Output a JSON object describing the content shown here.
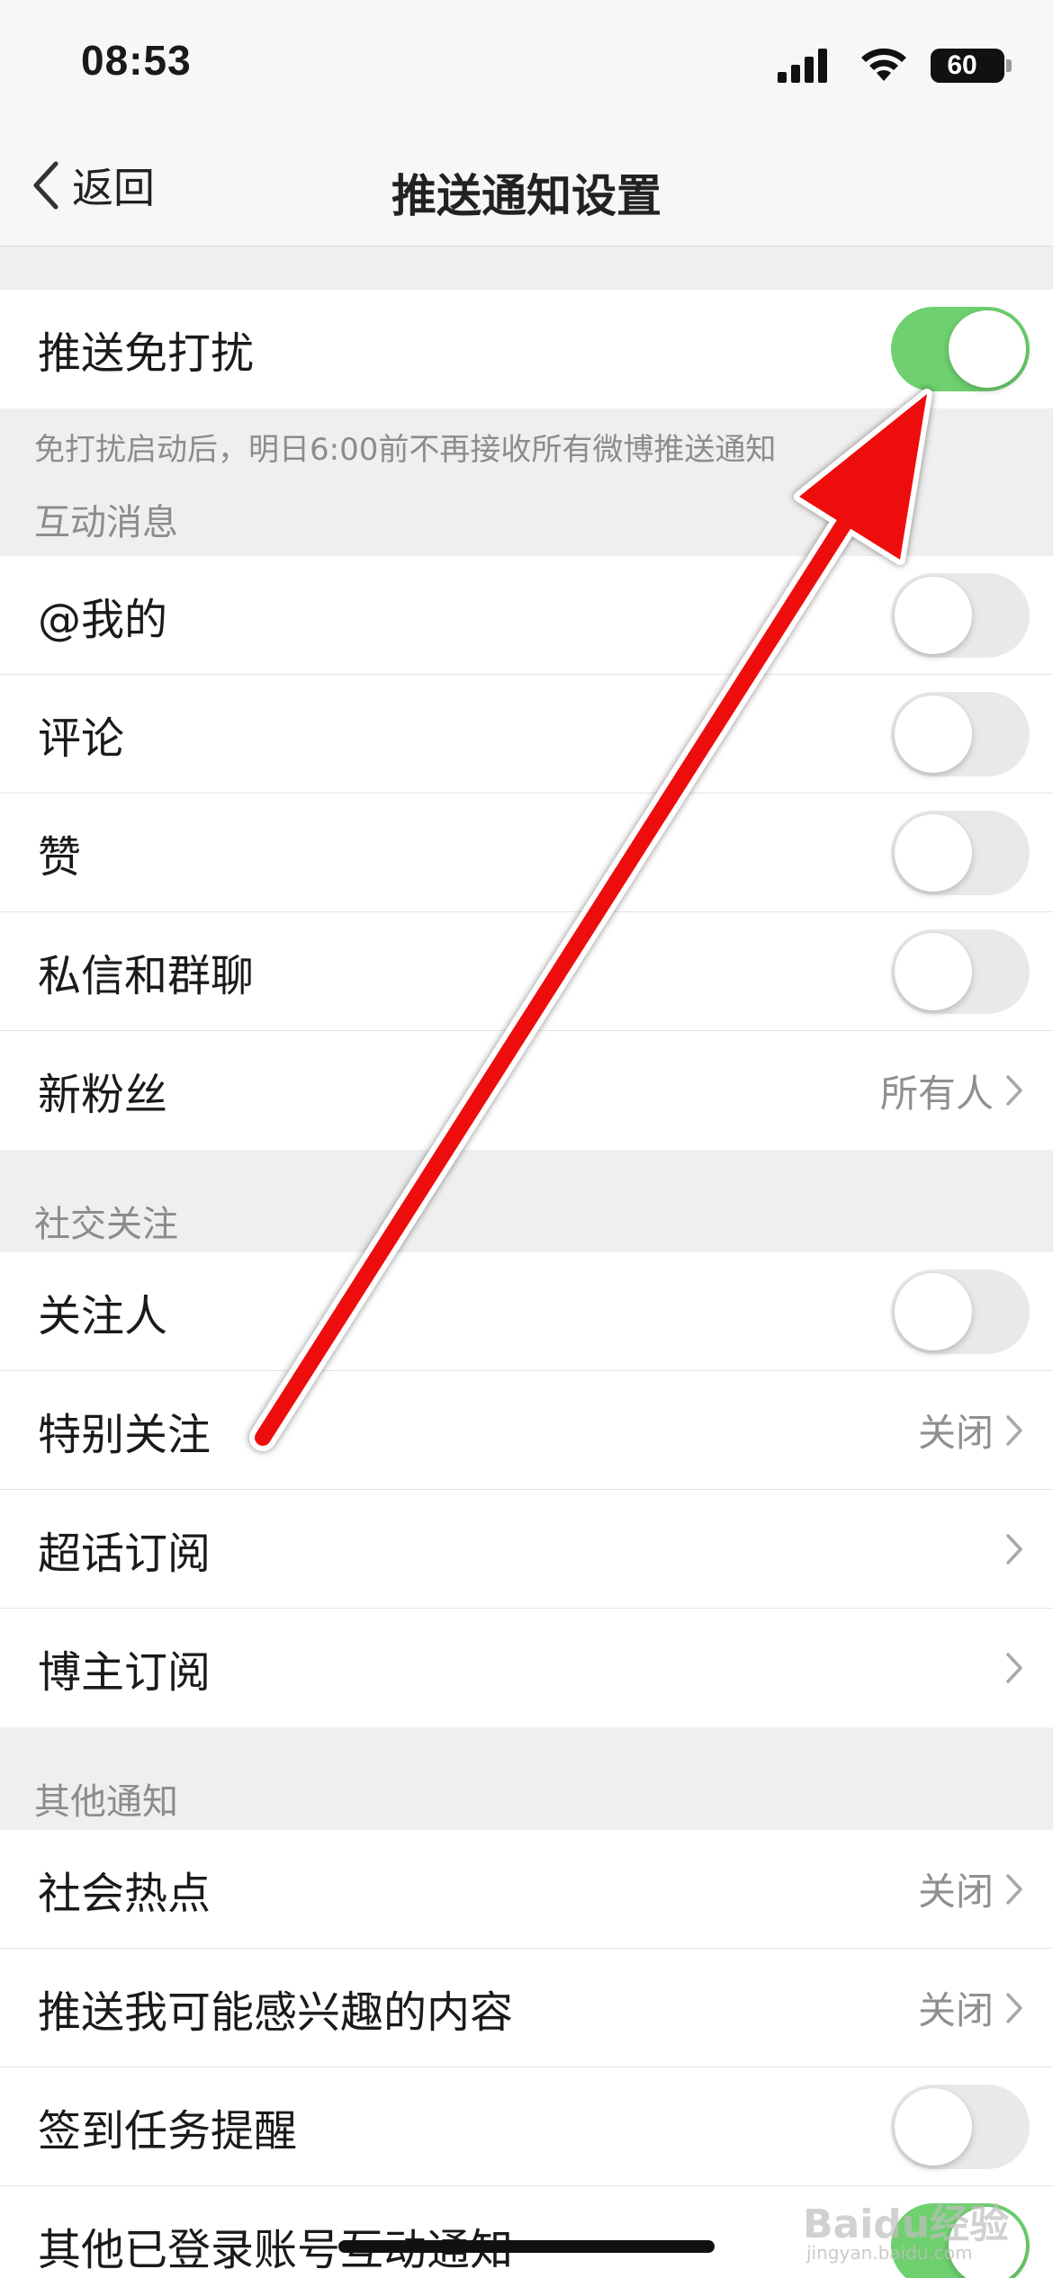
{
  "status_bar": {
    "time": "08:53",
    "battery": "60",
    "icons": [
      "signal-icon",
      "wifi-icon",
      "battery-icon"
    ]
  },
  "nav": {
    "back_label": "返回",
    "title": "推送通知设置"
  },
  "dnd": {
    "label": "推送免打扰",
    "enabled": true,
    "note": "免打扰启动后，明日6:00前不再接收所有微博推送通知"
  },
  "sections": [
    {
      "header": "互动消息",
      "rows": [
        {
          "label": "@我的",
          "type": "toggle",
          "enabled": false
        },
        {
          "label": "评论",
          "type": "toggle",
          "enabled": false
        },
        {
          "label": "赞",
          "type": "toggle",
          "enabled": false
        },
        {
          "label": "私信和群聊",
          "type": "toggle",
          "enabled": false
        },
        {
          "label": "新粉丝",
          "type": "link",
          "value": "所有人"
        }
      ]
    },
    {
      "header": "社交关注",
      "rows": [
        {
          "label": "关注人",
          "type": "toggle",
          "enabled": false
        },
        {
          "label": "特别关注",
          "type": "link",
          "value": "关闭"
        },
        {
          "label": "超话订阅",
          "type": "link",
          "value": ""
        },
        {
          "label": "博主订阅",
          "type": "link",
          "value": ""
        }
      ]
    },
    {
      "header": "其他通知",
      "rows": [
        {
          "label": "社会热点",
          "type": "link",
          "value": "关闭"
        },
        {
          "label": "推送我可能感兴趣的内容",
          "type": "link",
          "value": "关闭"
        },
        {
          "label": "签到任务提醒",
          "type": "toggle",
          "enabled": false
        },
        {
          "label": "其他已登录账号互动通知",
          "type": "toggle",
          "enabled": true
        }
      ]
    }
  ],
  "colors": {
    "toggle_on": "#6fd06f",
    "toggle_off": "#e9e9ea",
    "annotation_arrow": "#ee1111"
  },
  "watermark": {
    "main": "Baidu经验",
    "sub": "jingyan.baidu.com"
  }
}
